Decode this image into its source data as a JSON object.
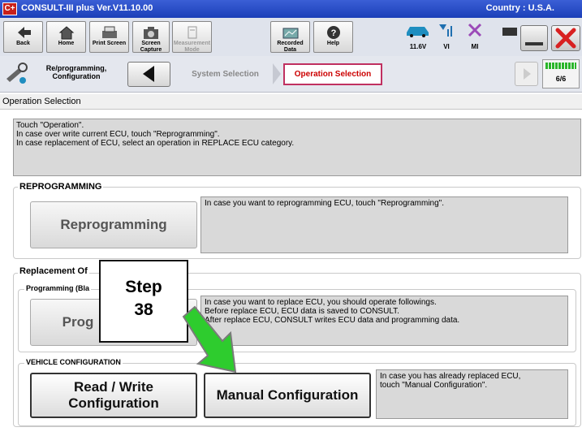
{
  "titlebar": {
    "logo": "C+",
    "title": "CONSULT-III plus  Ver.V11.10.00",
    "country": "Country : U.S.A."
  },
  "toolbar": {
    "buttons": [
      {
        "label": "Back",
        "icon": "back-arrow-icon"
      },
      {
        "label": "Home",
        "icon": "home-icon"
      },
      {
        "label": "Print Screen",
        "icon": "printer-icon"
      },
      {
        "label": "Screen Capture",
        "icon": "camera-icon"
      },
      {
        "label": "Measurement Mode",
        "icon": "meter-icon"
      },
      {
        "label": "Recorded Data",
        "icon": "recorded-data-icon"
      },
      {
        "label": "Help",
        "icon": "help-icon"
      }
    ],
    "status": [
      {
        "label": "11.6V",
        "icon": "car-icon"
      },
      {
        "label": "VI",
        "icon": "vi-signal-icon"
      },
      {
        "label": "MI",
        "icon": "mi-x-icon"
      }
    ]
  },
  "navbar": {
    "label": "Re/programming, Configuration",
    "crumbs": [
      "System Selection",
      "Operation Selection"
    ],
    "progress_text": "6/6",
    "progress_fraction": 1.0
  },
  "screen_title": "Operation Selection",
  "instructions": [
    "Touch \"Operation\".",
    "In case over write current ECU, touch \"Reprogramming\".",
    "In case replacement of ECU, select an operation in REPLACE ECU category."
  ],
  "reprogramming": {
    "title": "REPROGRAMMING",
    "button": "Reprogramming",
    "desc": "In case you want to reprogramming ECU, touch \"Reprogramming\"."
  },
  "replacement": {
    "title": "Replacement Of",
    "sub_title": "Programming (Bla",
    "button": "Prog",
    "desc": [
      "In case you want to replace ECU, you should operate followings.",
      "Before replace ECU, ECU data is saved to CONSULT.",
      "After replace ECU, CONSULT writes ECU data and programming data."
    ]
  },
  "vehicle_config": {
    "title": "VEHICLE CONFIGURATION",
    "read_write_line1": "Read / Write",
    "read_write_line2": "Configuration",
    "manual": "Manual Configuration",
    "desc": [
      "In case you has already replaced ECU,",
      "touch \"Manual Configuration\"."
    ]
  },
  "callout": {
    "line1": "Step",
    "line2": "38"
  },
  "colors": {
    "titlebar": "#2448c8",
    "arrow": "#22cc22",
    "active_crumb": "#c03060"
  }
}
